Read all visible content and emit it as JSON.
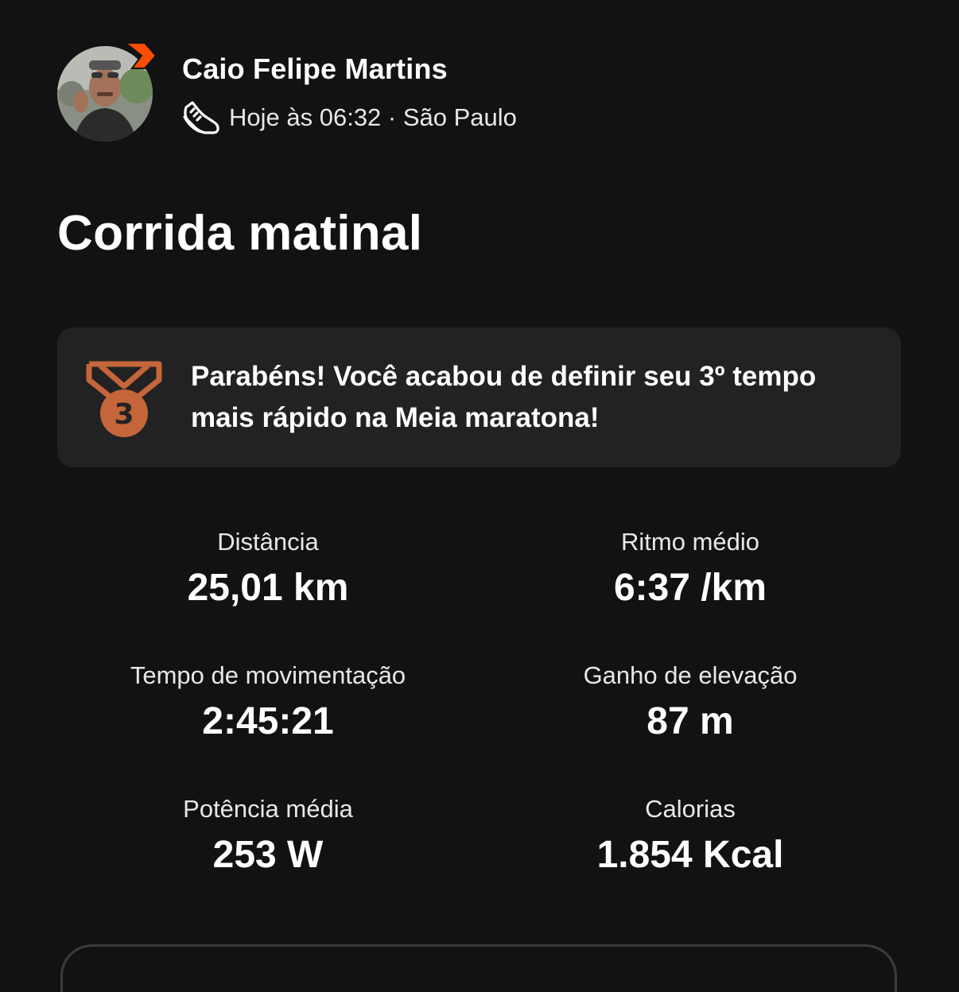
{
  "athlete": {
    "name": "Caio Felipe Martins",
    "meta": "Hoje às 06:32 · São Paulo",
    "activity_icon": "running-shoe-icon",
    "badge_icon": "subscriber-chevron-icon",
    "badge_color": "#FC4C02"
  },
  "activity": {
    "title": "Corrida matinal"
  },
  "achievement": {
    "icon": "bronze-medal-3-icon",
    "medal_number": "3",
    "medal_color": "#C4663A",
    "text": "Parabéns! Você acabou de definir seu 3º tempo mais rápido na Meia maratona!"
  },
  "stats": [
    {
      "label": "Distância",
      "value": "25,01 km"
    },
    {
      "label": "Ritmo médio",
      "value": "6:37 /km"
    },
    {
      "label": "Tempo de movimentação",
      "value": "2:45:21"
    },
    {
      "label": "Ganho de elevação",
      "value": "87 m"
    },
    {
      "label": "Potência média",
      "value": "253 W"
    },
    {
      "label": "Calorias",
      "value": "1.854 Kcal"
    }
  ],
  "colors": {
    "background": "#121212",
    "card": "#222222",
    "text": "#FFFFFF"
  }
}
